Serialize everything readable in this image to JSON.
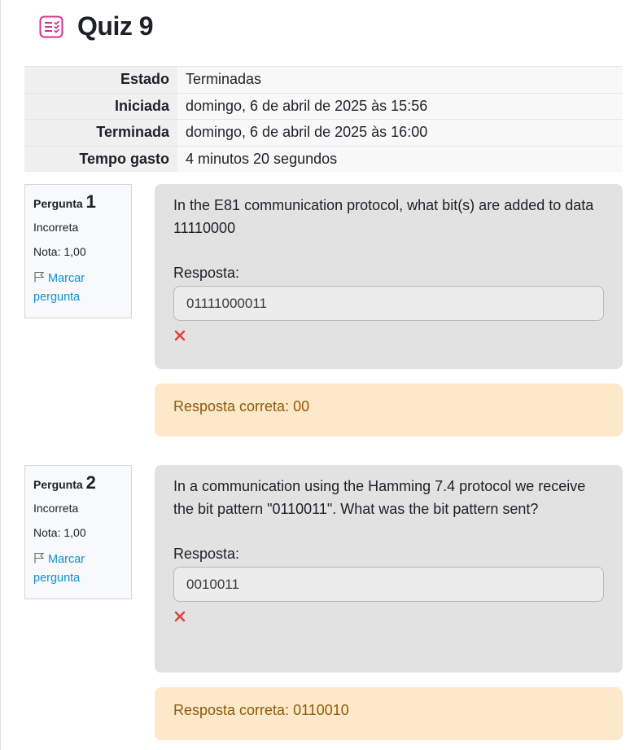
{
  "header": {
    "title": "Quiz 9",
    "icon": "quiz-icon"
  },
  "summary": {
    "rows": [
      {
        "label": "Estado",
        "value": "Terminadas"
      },
      {
        "label": "Iniciada",
        "value": "domingo, 6 de abril de 2025 às 15:56"
      },
      {
        "label": "Terminada",
        "value": "domingo, 6 de abril de 2025 às 16:00"
      },
      {
        "label": "Tempo gasto",
        "value": "4 minutos 20 segundos"
      }
    ]
  },
  "questions": [
    {
      "prefix": "Pergunta",
      "number": "1",
      "state": "Incorreta",
      "grade": "Nota: 1,00",
      "flag_label": "Marcar pergunta",
      "text": "In the E81 communication protocol, what bit(s) are added to data 11110000",
      "answer_label": "Resposta:",
      "answer_value": "01111000011",
      "feedback": "Resposta correta: 00"
    },
    {
      "prefix": "Pergunta",
      "number": "2",
      "state": "Incorreta",
      "grade": "Nota: 1,00",
      "flag_label": "Marcar pergunta",
      "text": "In a communication using the Hamming 7.4 protocol we receive the bit pattern \"0110011\". What was the bit pattern sent?",
      "answer_label": "Resposta:",
      "answer_value": "0010011",
      "feedback": "Resposta correta: 0110010"
    }
  ],
  "colors": {
    "accent_icon": "#d6318f",
    "link": "#0f8fd8",
    "wrong": "#e0413a",
    "feedback_bg": "#fde8c9",
    "feedback_text": "#8d5b0a"
  }
}
